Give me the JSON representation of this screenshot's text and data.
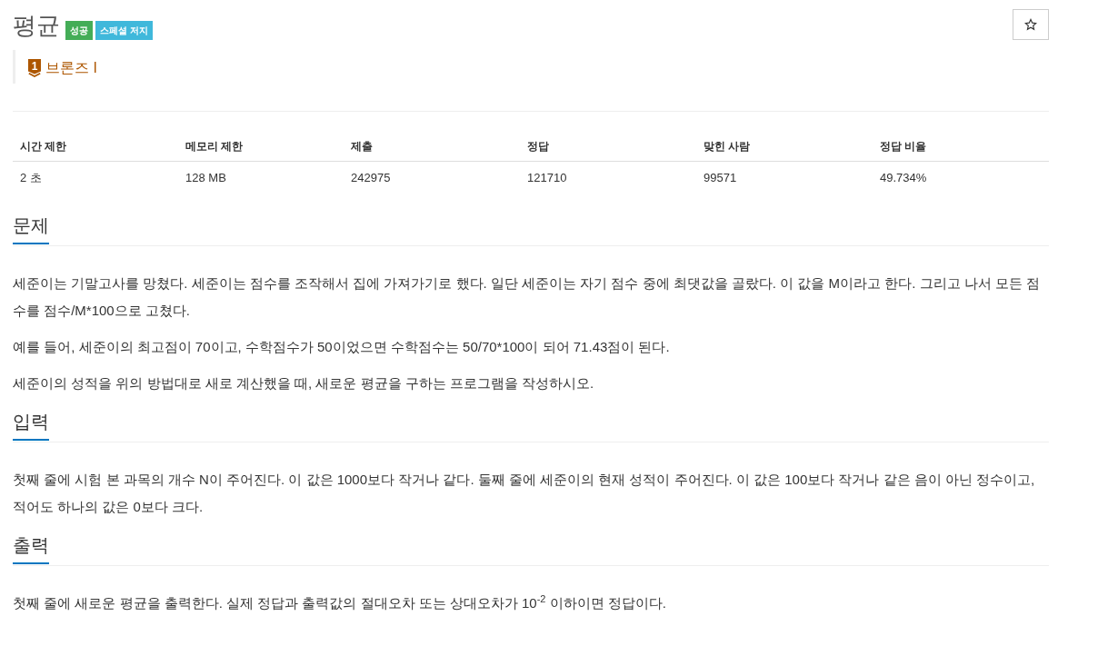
{
  "header": {
    "title": "평균",
    "tags": [
      {
        "label": "성공",
        "kind": "success"
      },
      {
        "label": "스페셜 저지",
        "kind": "info"
      }
    ],
    "favorite": {
      "on": false
    }
  },
  "tier": {
    "number": "1",
    "label": "브론즈 I"
  },
  "stats_table": {
    "columns": [
      "시간 제한",
      "메모리 제한",
      "제출",
      "정답",
      "맞힌 사람",
      "정답 비율"
    ],
    "rows": [
      [
        "2 초",
        "128 MB",
        "242975",
        "121710",
        "99571",
        "49.734%"
      ]
    ]
  },
  "sections": [
    {
      "heading": "문제",
      "paragraphs": [
        "세준이는 기말고사를 망쳤다. 세준이는 점수를 조작해서 집에 가져가기로 했다. 일단 세준이는 자기 점수 중에 최댓값을 골랐다. 이 값을 M이라고 한다. 그리고 나서 모든 점수를 점수/M*100으로 고쳤다.",
        "예를 들어, 세준이의 최고점이 70이고, 수학점수가 50이었으면 수학점수는 50/70*100이 되어 71.43점이 된다.",
        "세준이의 성적을 위의 방법대로 새로 계산했을 때, 새로운 평균을 구하는 프로그램을 작성하시오."
      ]
    },
    {
      "heading": "입력",
      "paragraphs": [
        "첫째 줄에 시험 본 과목의 개수 N이 주어진다. 이 값은 1000보다 작거나 같다. 둘째 줄에 세준이의 현재 성적이 주어진다. 이 값은 100보다 작거나 같은 음이 아닌 정수이고, 적어도 하나의 값은 0보다 크다."
      ]
    },
    {
      "heading": "출력",
      "paragraphs": [
        "첫째 줄에 새로운 평균을 출력한다. 실제 정답과 출력값의 절대오차 또는 상대오차가 10$^{-2}$ 이하이면 정답이다."
      ]
    }
  ]
}
